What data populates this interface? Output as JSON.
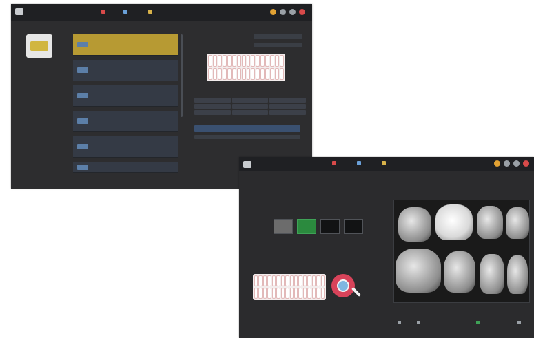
{
  "window1": {
    "section_left": "",
    "section_mid": "",
    "section_right": "",
    "card_caption": "",
    "list_items": [
      {
        "title": "",
        "sub": "",
        "selected": true
      },
      {
        "title": "",
        "sub": "",
        "selected": false
      },
      {
        "title": "",
        "sub": "",
        "selected": false
      },
      {
        "title": "",
        "sub": "",
        "selected": false
      },
      {
        "title": "",
        "sub": "",
        "selected": false
      },
      {
        "title": "",
        "sub": "",
        "selected": false
      }
    ],
    "grid_labels": [
      "",
      "",
      "",
      "",
      "",
      "",
      "",
      "",
      ""
    ],
    "bar_label": ""
  },
  "window2": {
    "header_label": "",
    "header_right": ""
  },
  "colors": {
    "window_bg": "#2d2d2f",
    "topbar_bg": "#1f2023",
    "selected_item": "#b79a33",
    "sensor_green": "#2b8a3e",
    "accent_red": "#d8435a"
  },
  "icons": [
    "app-logo-icon",
    "gear-icon",
    "user-icon",
    "close-icon",
    "magnifier-icon",
    "tooth-chart-icon",
    "sensor-icon"
  ]
}
